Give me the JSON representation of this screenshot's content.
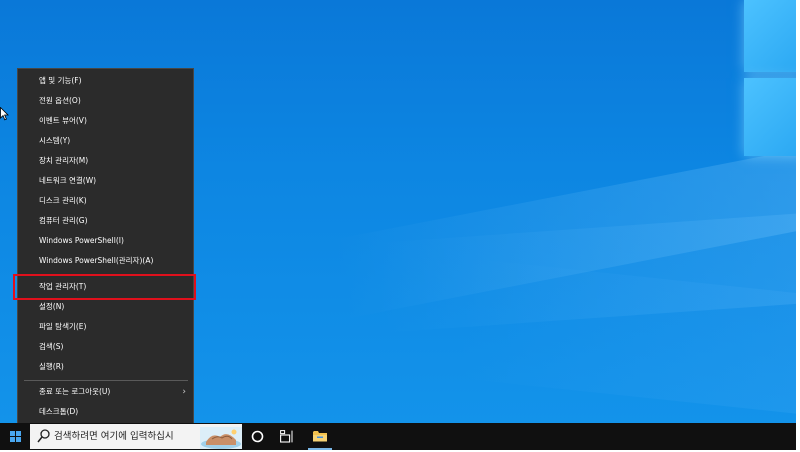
{
  "menu": {
    "items": [
      {
        "label": "앱 및 기능(F)"
      },
      {
        "label": "전원 옵션(O)"
      },
      {
        "label": "이벤트 뷰어(V)"
      },
      {
        "label": "시스템(Y)"
      },
      {
        "label": "장치 관리자(M)"
      },
      {
        "label": "네트워크 연결(W)"
      },
      {
        "label": "디스크 관리(K)"
      },
      {
        "label": "컴퓨터 관리(G)"
      },
      {
        "label": "Windows PowerShell(I)"
      },
      {
        "label": "Windows PowerShell(관리자)(A)"
      },
      {
        "label": "작업 관리자(T)"
      },
      {
        "label": "설정(N)"
      },
      {
        "label": "파일 탐색기(E)"
      },
      {
        "label": "검색(S)"
      },
      {
        "label": "실행(R)"
      },
      {
        "label": "종료 또는 로그아웃(U)"
      },
      {
        "label": "데스크톱(D)"
      }
    ],
    "highlighted_item": "작업 관리자(T)",
    "highlight_color": "#e0101c"
  },
  "taskbar": {
    "search_placeholder": "검색하려면 여기에 입력하십시",
    "background_color": "#101010"
  },
  "icons": {
    "start": "windows-logo-icon",
    "search": "search-icon",
    "task_view": "task-view-icon",
    "timeline": "timeline-icon",
    "file_explorer": "folder-icon",
    "submenu": "chevron-right-icon"
  },
  "colors": {
    "desktop_blue": "#0d86e2",
    "menu_background": "#2b2b2b",
    "menu_text": "#ffffff",
    "folder_yellow": "#f2c14e"
  }
}
